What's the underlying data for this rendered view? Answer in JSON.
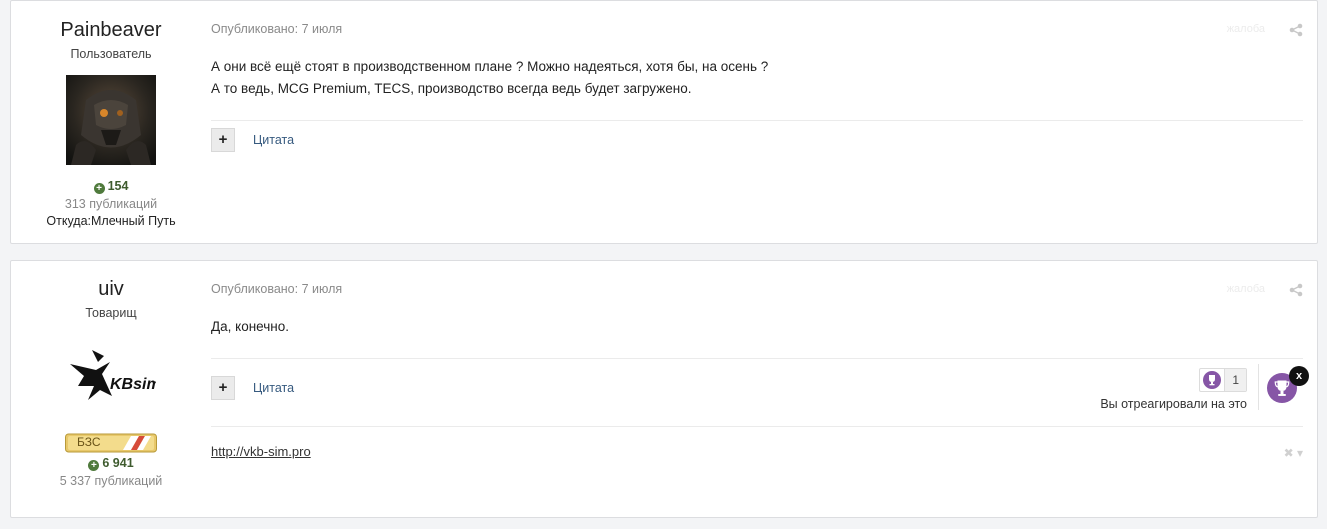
{
  "posts": [
    {
      "author": {
        "name": "Painbeaver",
        "title": "Пользователь",
        "reputation": "154",
        "publications": "313 публикаций",
        "location_label": "Откуда:",
        "location_value": "Млечный Путь"
      },
      "meta": "Опубликовано: 7 июля",
      "corner_text": "жалоба",
      "content_lines": [
        "А они всё ещё стоят в производственном плане ? Можно надеяться, хотя бы, на осень ?",
        "А то ведь, MCG Premium, TECS, производство всегда ведь будет загружено."
      ],
      "quote_label": "Цитата"
    },
    {
      "author": {
        "name": "uiv",
        "title": "Товарищ",
        "logo_text": "KBsim",
        "rank_badge": "БЗС",
        "reputation": "6 941",
        "publications": "5 337 публикаций"
      },
      "meta": "Опубликовано: 7 июля",
      "corner_text": "жалоба",
      "content_lines": [
        "Да, конечно."
      ],
      "quote_label": "Цитата",
      "reaction_count": "1",
      "reaction_text": "Вы отреагировали на это",
      "close_label": "x",
      "signature_link": "http://vkb-sim.pro"
    }
  ],
  "colors": {
    "reputation": "#3e5b2e",
    "quote_link": "#375a7f",
    "reaction_purple": "#8656a6"
  },
  "icons": [
    "plus-circle-icon",
    "share-icon",
    "trophy-icon",
    "close-icon",
    "caret-down-icon"
  ]
}
